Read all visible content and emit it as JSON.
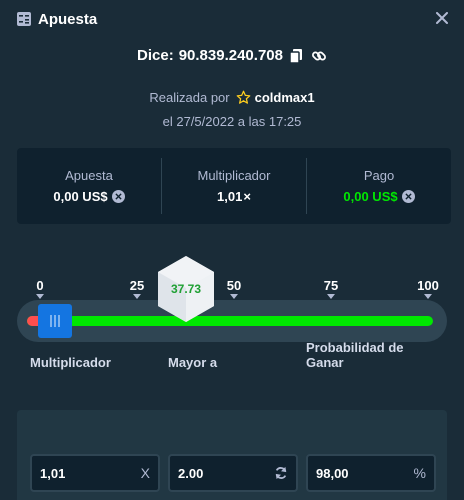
{
  "header": {
    "title": "Apuesta",
    "title_icon": "bet-slip-icon",
    "close_icon": "close-icon"
  },
  "dice": {
    "prefix": "Dice:",
    "id": "90.839.240.708",
    "copy_icon": "copy-icon",
    "link_icon": "link-icon"
  },
  "placed": {
    "label": "Realizada por",
    "star_icon": "star-icon",
    "user": "coldmax1",
    "date": "el 27/5/2022 a las 17:25"
  },
  "stats": {
    "bet_label": "Apuesta",
    "bet_value": "0,00 US$",
    "multiplier_label": "Multiplicador",
    "multiplier_value": "1,01",
    "multiplier_suffix": "×",
    "payout_label": "Pago",
    "payout_value": "0,00 US$",
    "currency_icon": "currency-coin-icon"
  },
  "slider": {
    "ticks": [
      "0",
      "25",
      "50",
      "75",
      "100"
    ],
    "roll_result": "37.73",
    "handle_value": 2.0
  },
  "inputs": {
    "multiplier_label": "Multiplicador",
    "multiplier_value": "1,01",
    "multiplier_suffix": "X",
    "over_label": "Mayor a",
    "over_value": "2.00",
    "over_icon": "refresh-icon",
    "chance_label": "Probabilidad de Ganar",
    "chance_value": "98,00",
    "chance_suffix": "%"
  },
  "colors": {
    "background": "#1a2c38",
    "panel": "#0f212e",
    "green": "#00e701",
    "handle_blue": "#1475e1",
    "track": "#2f4553"
  }
}
